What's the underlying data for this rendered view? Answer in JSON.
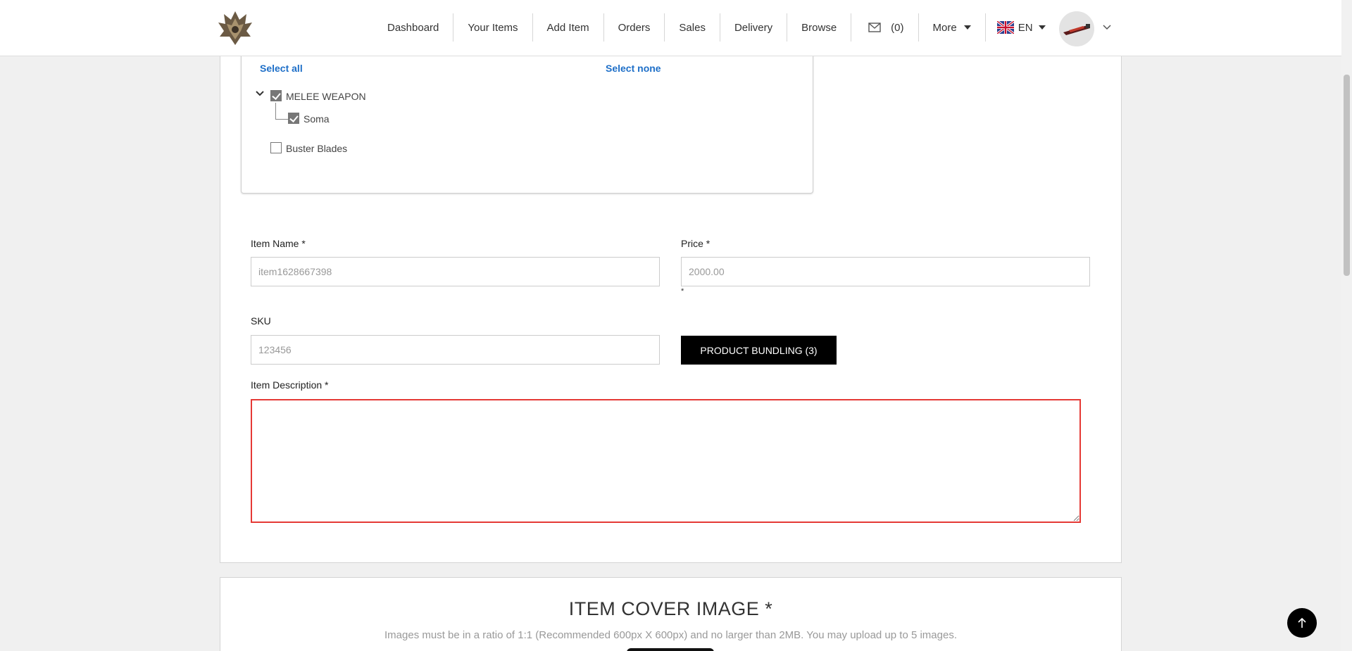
{
  "nav": {
    "items": [
      "Dashboard",
      "Your Items",
      "Add Item",
      "Orders",
      "Sales",
      "Delivery",
      "Browse"
    ],
    "mail_count": "(0)",
    "more_label": "More",
    "language": "EN"
  },
  "category_tree": {
    "select_all": "Select all",
    "select_none": "Select none",
    "nodes": [
      {
        "label": "MELEE WEAPON",
        "checked": true,
        "expanded": true
      },
      {
        "label": "Soma",
        "checked": true
      },
      {
        "label": "Buster Blades",
        "checked": false
      }
    ]
  },
  "form": {
    "item_name_label": "Item Name *",
    "item_name_value": "item1628667398",
    "price_label": "Price *",
    "price_value": "2000.00",
    "price_note": "*",
    "sku_label": "SKU",
    "sku_value": "123456",
    "bundling_button": "PRODUCT BUNDLING (3)",
    "description_label": "Item Description *",
    "description_value": ""
  },
  "cover": {
    "title": "ITEM COVER IMAGE *",
    "subtitle": "Images must be in a ratio of 1:1 (Recommended 600px X 600px) and no larger than 2MB. You may upload up to 5 images."
  },
  "colors": {
    "link": "#1e6fc8",
    "error_border": "#e53935",
    "button_bg": "#000000"
  },
  "icons": [
    "logo-icon",
    "mail-icon",
    "caret-down-icon",
    "uk-flag-icon",
    "chevron-down-icon",
    "arrow-up-icon"
  ]
}
